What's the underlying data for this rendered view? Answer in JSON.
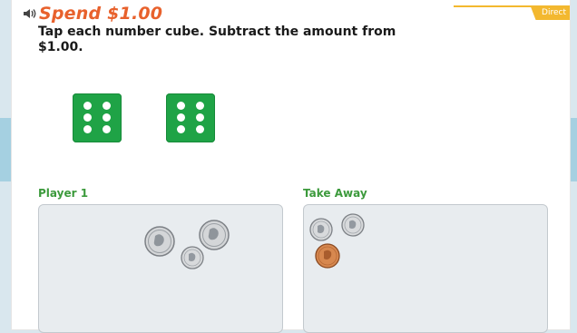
{
  "header": {
    "title": "Spend $1.00",
    "instructions": "Tap each number cube. Subtract the amount from $1.00.",
    "directions_tab": "Direct"
  },
  "dice": [
    {
      "name": "number-cube-1",
      "value": 6
    },
    {
      "name": "number-cube-2",
      "value": 6
    }
  ],
  "player": {
    "label": "Player 1",
    "coins": [
      "quarter",
      "quarter",
      "dime"
    ]
  },
  "take_away": {
    "label": "Take Away",
    "coins": [
      "dime",
      "dime",
      "penny"
    ]
  },
  "colors": {
    "title": "#e8612c",
    "die": "#1fa346",
    "label_green": "#3c9a3c",
    "tab": "#f3b82f"
  }
}
